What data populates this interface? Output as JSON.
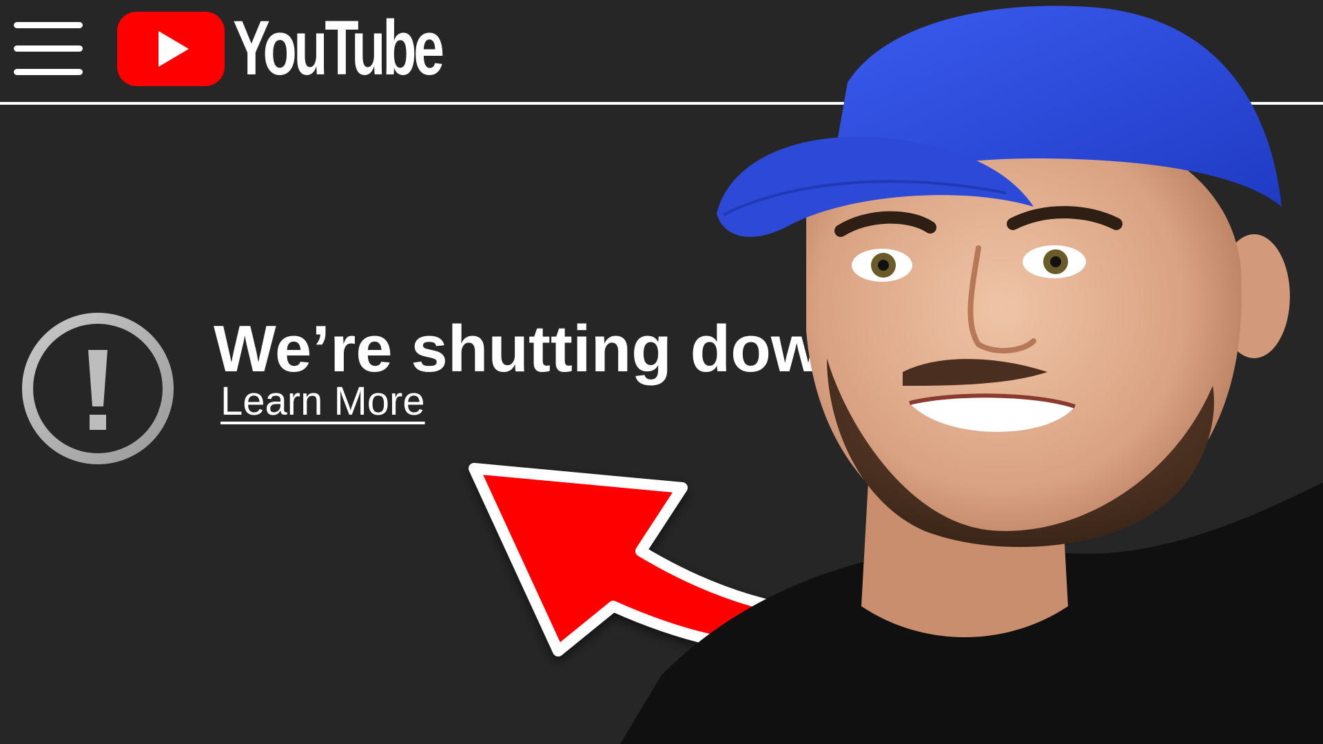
{
  "header": {
    "menu_icon": "hamburger-menu-icon",
    "logo_icon": "youtube-play-icon",
    "logo_text": "YouTube"
  },
  "notice": {
    "icon": "exclamation-circle-icon",
    "title": "We’re shutting down.",
    "link_label": "Learn More"
  },
  "overlay": {
    "arrow_icon": "curved-arrow-icon",
    "arrow_color": "#ff0000",
    "cap_color": "#2d4ddb",
    "person": "presenter-portrait"
  },
  "colors": {
    "background": "#262626",
    "text": "#ffffff",
    "brand_red": "#ff0000",
    "icon_gray": "#b3b3b3"
  }
}
